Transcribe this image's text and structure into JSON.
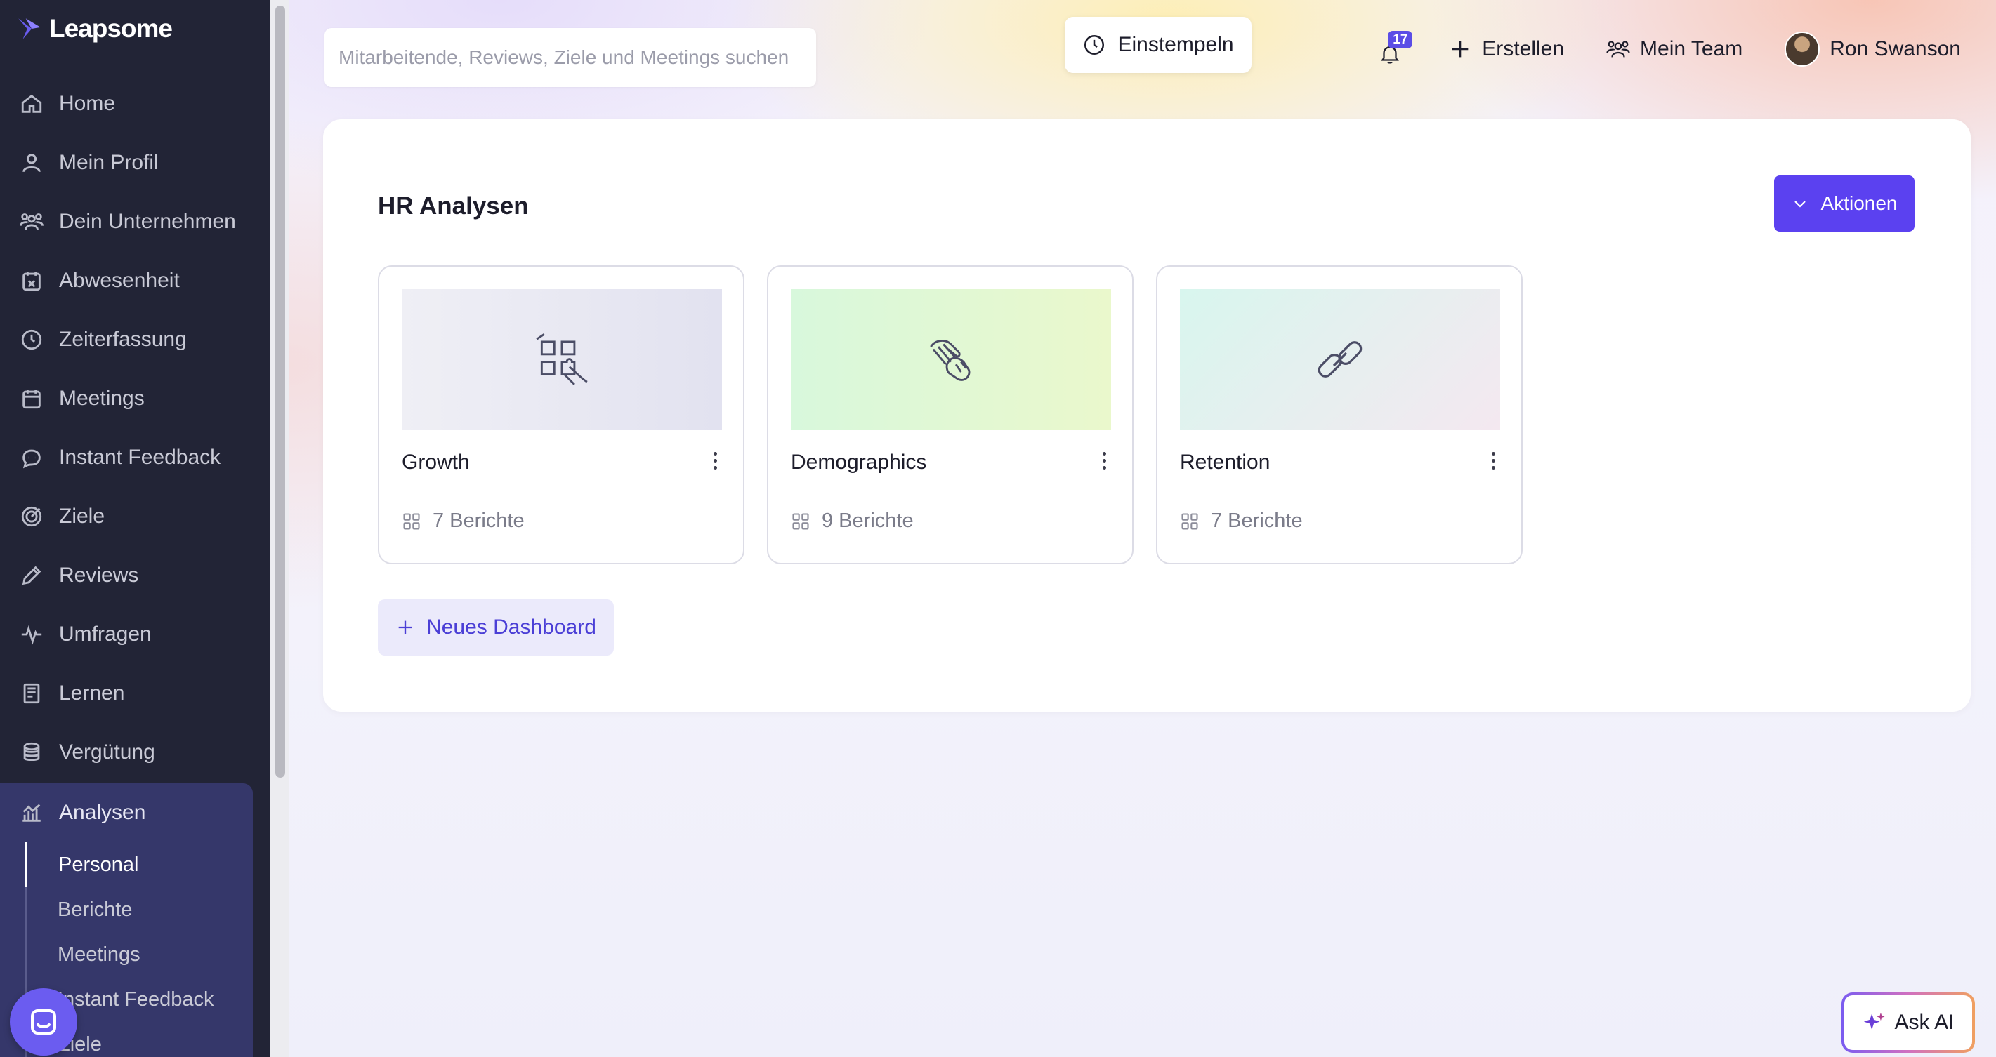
{
  "brand": {
    "name": "Leapsome"
  },
  "sidebar": {
    "items": [
      {
        "label": "Home",
        "icon": "home-icon"
      },
      {
        "label": "Mein Profil",
        "icon": "user-icon"
      },
      {
        "label": "Dein Unternehmen",
        "icon": "users-icon"
      },
      {
        "label": "Abwesenheit",
        "icon": "calendar-x-icon"
      },
      {
        "label": "Zeiterfassung",
        "icon": "clock-icon"
      },
      {
        "label": "Meetings",
        "icon": "calendar-icon"
      },
      {
        "label": "Instant Feedback",
        "icon": "chat-icon"
      },
      {
        "label": "Ziele",
        "icon": "target-icon"
      },
      {
        "label": "Reviews",
        "icon": "pencil-icon"
      },
      {
        "label": "Umfragen",
        "icon": "pulse-icon"
      },
      {
        "label": "Lernen",
        "icon": "book-icon"
      },
      {
        "label": "Vergütung",
        "icon": "coins-icon"
      }
    ],
    "active_section": {
      "label": "Analysen",
      "icon": "chart-icon"
    },
    "sub_items": [
      {
        "label": "Personal",
        "active": true
      },
      {
        "label": "Berichte",
        "active": false
      },
      {
        "label": "Meetings",
        "active": false
      },
      {
        "label": "Instant Feedback",
        "active": false
      },
      {
        "label": "Ziele",
        "active": false
      }
    ]
  },
  "topbar": {
    "search_placeholder": "Mitarbeitende, Reviews, Ziele und Meetings suchen",
    "clock_in_label": "Einstempeln",
    "notification_count": "17",
    "create_label": "Erstellen",
    "team_label": "Mein Team",
    "user_name": "Ron Swanson"
  },
  "main": {
    "title": "HR Analysen",
    "actions_label": "Aktionen",
    "dashboards": [
      {
        "name": "Growth",
        "reports": "7 Berichte",
        "icon": "puzzle-icon"
      },
      {
        "name": "Demographics",
        "reports": "9 Berichte",
        "icon": "hands-icon"
      },
      {
        "name": "Retention",
        "reports": "7 Berichte",
        "icon": "link-icon"
      }
    ],
    "new_dashboard_label": "Neues Dashboard"
  },
  "ask_ai_label": "Ask AI",
  "colors": {
    "sidebar_bg": "#222436",
    "sidebar_active_bg": "#35376a",
    "accent": "#5b41f0",
    "badge": "#5b4de6",
    "new_dashboard_bg": "#ebeafb",
    "growth_thumb": "#e6e6f3",
    "demographics_thumb": "#e3f8d6",
    "retention_thumb": "#dff4ef"
  }
}
